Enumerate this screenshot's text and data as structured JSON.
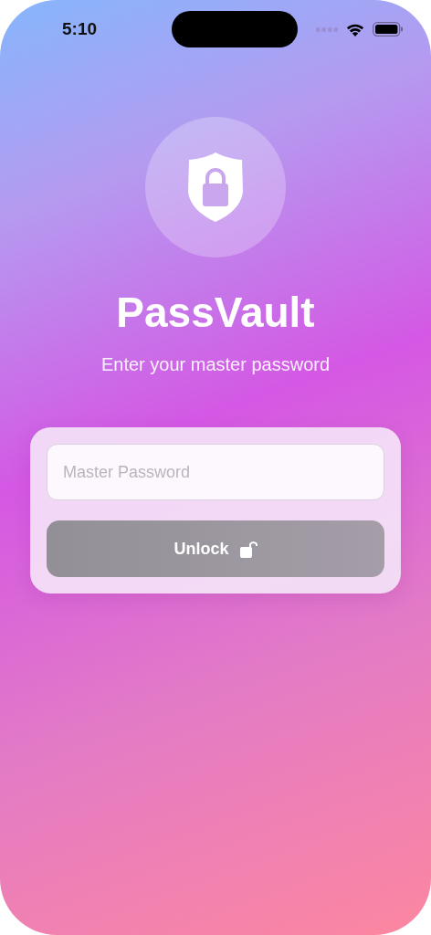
{
  "status_bar": {
    "time": "5:10"
  },
  "app": {
    "title": "PassVault",
    "subtitle": "Enter your master password"
  },
  "form": {
    "password_field": {
      "placeholder": "Master Password"
    },
    "unlock_button": {
      "label": "Unlock",
      "disabled": true
    }
  }
}
